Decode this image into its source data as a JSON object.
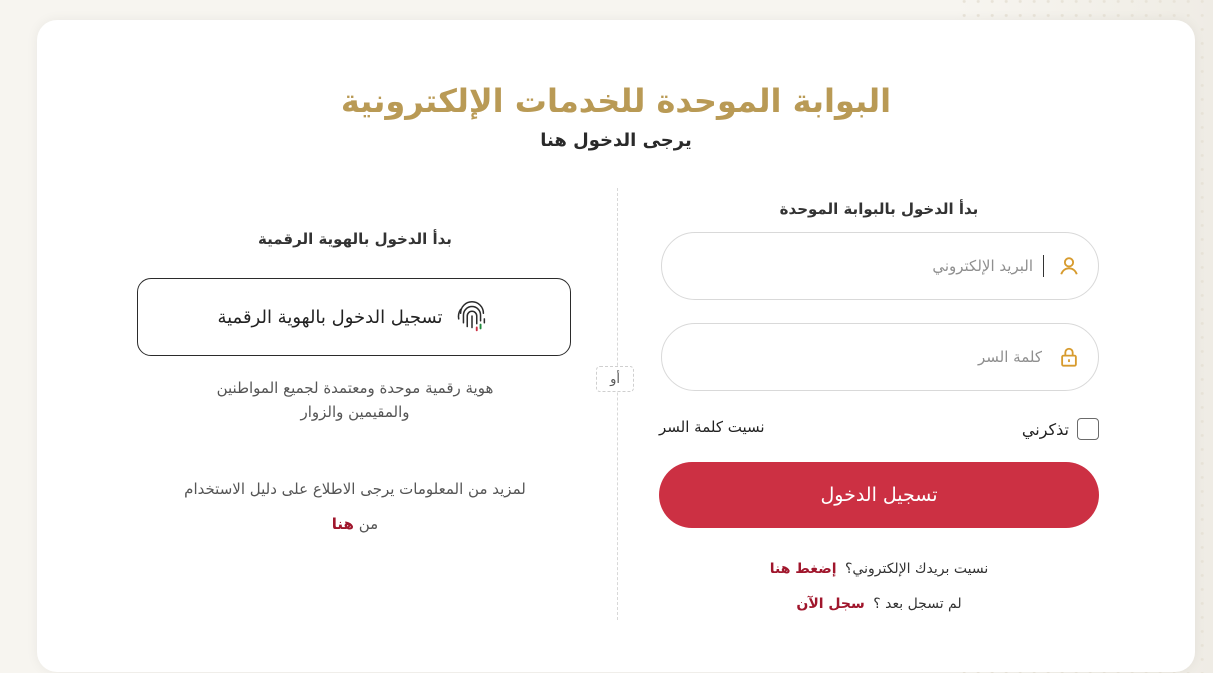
{
  "header": {
    "title": "البوابة الموحدة للخدمات الإلكترونية",
    "subtitle": "يرجى الدخول هنا"
  },
  "divider": {
    "or_label": "أو"
  },
  "portal_login": {
    "heading": "بدأ الدخول بالبوابة الموحدة",
    "email_placeholder": "البريد الإلكتروني",
    "password_placeholder": "كلمة السر",
    "remember_label": "تذكرني",
    "forgot_password": "نسيت كلمة السر",
    "login_button": "تسجيل الدخول",
    "forgot_email_text": "نسيت بريدك الإلكتروني؟",
    "forgot_email_link": "إضغط هنا",
    "not_registered_text": "لم تسجل بعد ؟",
    "register_link": "سجل الآن",
    "icon_user": "user-icon",
    "icon_lock": "lock-icon"
  },
  "digital_id": {
    "heading": "بدأ الدخول بالهوية الرقمية",
    "button_label": "تسجيل الدخول بالهوية الرقمية",
    "icon": "fingerprint-icon",
    "description_line1": "هوية رقمية موحدة ومعتمدة لجميع المواطنين",
    "description_line2": "والمقيمين والزوار",
    "more_info": "لمزيد من المعلومات يرجى الاطلاع على دليل الاستخدام",
    "from_text": "من",
    "here_link": "هنا"
  },
  "colors": {
    "title_gold": "#b99a55",
    "primary_red": "#cc3043",
    "link_red": "#a0162c",
    "icon_orange": "#d79b2e"
  }
}
